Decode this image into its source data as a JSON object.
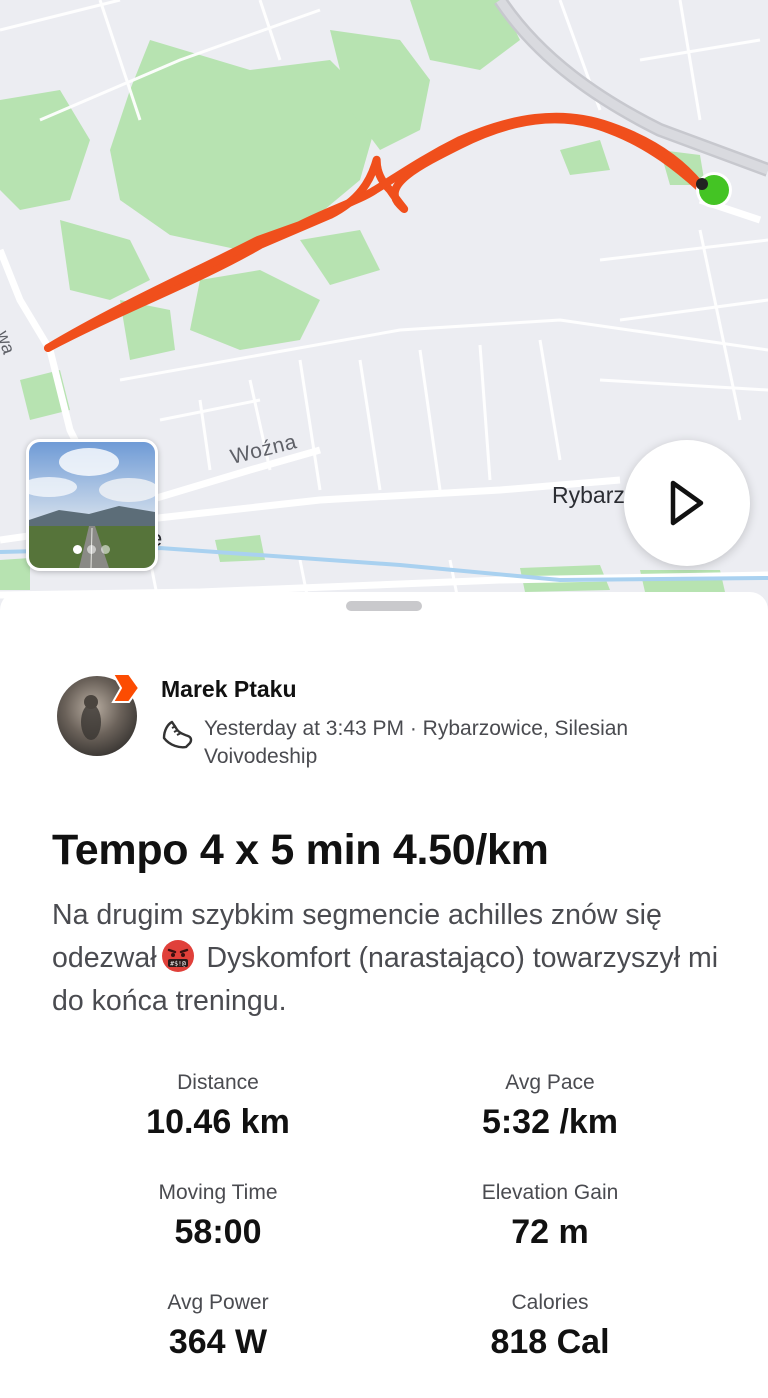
{
  "map": {
    "labels": {
      "wozna": "Woźna",
      "rybarz": "Rybarz",
      "partial_e": "e",
      "partial_wa": "wa"
    },
    "route_color": "#f04f1c",
    "start_marker_color": "#44c424",
    "photo_count": 3
  },
  "athlete": {
    "name": "Marek Ptaku",
    "meta": "Yesterday at 3:43 PM · Rybarzowice, Silesian Voivodeship",
    "activity_icon": "running-shoe-icon"
  },
  "activity": {
    "title": "Tempo 4 x 5 min 4.50/km",
    "description_part1": "Na drugim szybkim segmencie achilles znów się odezwał",
    "description_emoji": "face-with-symbols-on-mouth",
    "description_part2": "Dyskomfort (narastająco) towarzyszył mi do końca treningu."
  },
  "stats": {
    "distance": {
      "label": "Distance",
      "value": "10.46 km"
    },
    "avg_pace": {
      "label": "Avg Pace",
      "value": "5:32 /km"
    },
    "moving_time": {
      "label": "Moving Time",
      "value": "58:00"
    },
    "elevation_gain": {
      "label": "Elevation Gain",
      "value": "72 m"
    },
    "avg_power": {
      "label": "Avg Power",
      "value": "364 W"
    },
    "calories": {
      "label": "Calories",
      "value": "818 Cal"
    }
  },
  "colors": {
    "brand_orange": "#fc4c02",
    "text_primary": "#111111",
    "text_secondary": "#4a4b50"
  }
}
